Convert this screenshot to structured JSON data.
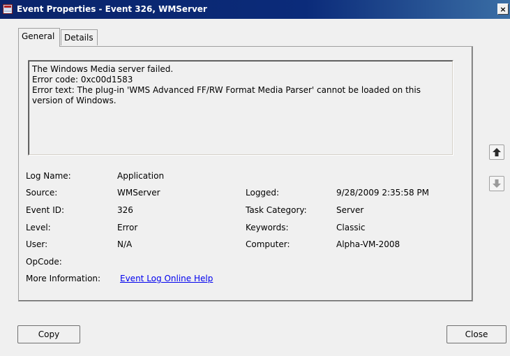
{
  "window": {
    "title": "Event Properties - Event 326, WMServer",
    "close_glyph": "×"
  },
  "tabs": [
    {
      "label": "General"
    },
    {
      "label": "Details"
    }
  ],
  "message": {
    "lines": [
      "The Windows Media server failed.",
      "Error code: 0xc00d1583",
      "Error text: The plug-in 'WMS Advanced FF/RW Format Media Parser' cannot be loaded on this",
      "version of Windows."
    ]
  },
  "fields": {
    "log_name": {
      "label": "Log Name:",
      "value": "Application"
    },
    "source": {
      "label": "Source:",
      "value": "WMServer"
    },
    "event_id": {
      "label": "Event ID:",
      "value": "326"
    },
    "level": {
      "label": "Level:",
      "value": "Error"
    },
    "user": {
      "label": "User:",
      "value": "N/A"
    },
    "opcode": {
      "label": "OpCode:",
      "value": ""
    },
    "more_info": {
      "label": "More Information:",
      "value": "Event Log Online Help"
    },
    "logged": {
      "label": "Logged:",
      "value": "9/28/2009 2:35:58 PM"
    },
    "task_category": {
      "label": "Task Category:",
      "value": "Server"
    },
    "keywords": {
      "label": "Keywords:",
      "value": "Classic"
    },
    "computer": {
      "label": "Computer:",
      "value": "Alpha-VM-2008"
    }
  },
  "buttons": {
    "copy": "Copy",
    "close": "Close",
    "prev_icon": "arrow-up-icon",
    "next_icon": "arrow-down-icon"
  },
  "colors": {
    "titlebar": "#0a246a",
    "link": "#0000ee",
    "background": "#f0f0f0"
  }
}
